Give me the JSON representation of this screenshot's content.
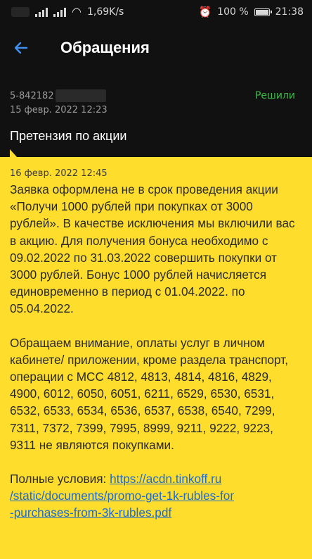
{
  "status_bar": {
    "speed": "1,69K/s",
    "battery": "100 %",
    "time": "21:38"
  },
  "header": {
    "title": "Обращения"
  },
  "ticket": {
    "id": "5-842182",
    "status": "Решили",
    "created": "15 февр. 2022 12:23",
    "subject": "Претензия по акции"
  },
  "message": {
    "date": "16 февр. 2022 12:45",
    "paragraph1": "Заявка оформлена не в срок проведения акции «Получи 1000 рублей при покупках от 3000 рублей». В качестве исключения мы включили вас в акцию. Для получения бонуса необходимо с 09.02.2022 по 31.03.2022 совершить покупки от 3000 рублей. Бонус 1000 рублей начисляется единовременно в период с 01.04.2022. по 05.04.2022.",
    "paragraph2": "Обращаем внимание, оплаты услуг в личном кабинете/ приложении, кроме раздела транспорт, операции с МСС 4812, 4813, 4814, 4816, 4829, 4900, 6012, 6050, 6051, 6211, 6529, 6530, 6531, 6532, 6533, 6534, 6536, 6537, 6538, 6540, 7299, 7311, 7372, 7399, 7995, 8999, 9211, 9222, 9223, 9311 не являются покупками.",
    "terms_label": "Полные условия:",
    "terms_link_line1": "https://acdn.tinkoff.ru",
    "terms_link_line2": "/static/documents/promo-get-1k-rubles-for",
    "terms_link_line3": "-purchases-from-3k-rubles.pdf"
  },
  "colors": {
    "accent": "#3f8ef0",
    "bubble": "#ffdd2d",
    "status_ok": "#3dbb4a",
    "link": "#1a6ad8"
  }
}
